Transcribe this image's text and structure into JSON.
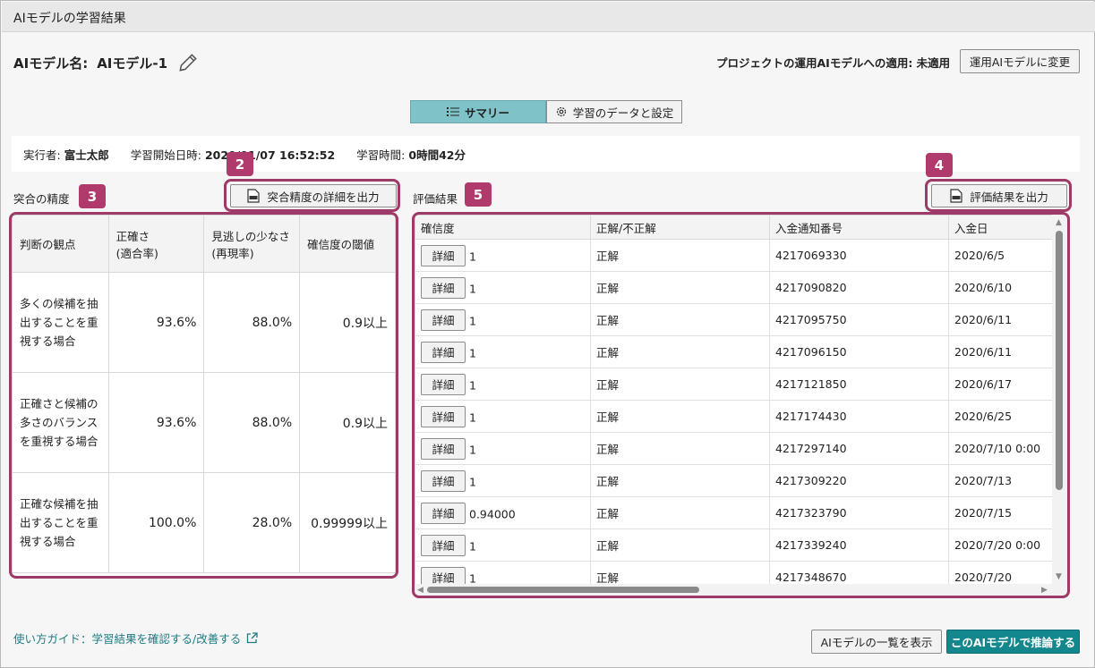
{
  "window": {
    "title": "AIモデルの学習結果"
  },
  "model": {
    "label": "AIモデル名:",
    "name": "AIモデル-1"
  },
  "apply": {
    "status_text": "プロジェクトの運用AIモデルへの適用: 未適用",
    "change_button": "運用AIモデルに変更"
  },
  "tabs": [
    {
      "label": "サマリー",
      "active": true
    },
    {
      "label": "学習のデータと設定",
      "active": false
    }
  ],
  "info": {
    "executor_label": "実行者:",
    "executor": "富士太郎",
    "start_label": "学習開始日時:",
    "start": "2020/01/07 16:52:52",
    "duration_label": "学習時間:",
    "duration": "0時間42分"
  },
  "accuracy": {
    "section_label": "突合の精度",
    "export_button": "突合精度の詳細を出力",
    "headers": [
      "判断の観点",
      "正確さ\n(適合率)",
      "見逃しの少なさ\n(再現率)",
      "確信度の閾値"
    ],
    "rows": [
      {
        "desc": "多くの候補を抽出することを重視する場合",
        "precision": "93.6%",
        "recall": "88.0%",
        "threshold": "0.9以上"
      },
      {
        "desc": "正確さと候補の多さのバランスを重視する場合",
        "precision": "93.6%",
        "recall": "88.0%",
        "threshold": "0.9以上"
      },
      {
        "desc": "正確な候補を抽出することを重視する場合",
        "precision": "100.0%",
        "recall": "28.0%",
        "threshold": "0.99999以上"
      }
    ]
  },
  "evaluation": {
    "section_label": "評価結果",
    "export_button": "評価結果を出力",
    "detail_label": "詳細",
    "headers": [
      "確信度",
      "正解/不正解",
      "入金通知番号",
      "入金日"
    ],
    "rows": [
      {
        "confidence": "1",
        "result": "正解",
        "number": "4217069330",
        "date": "2020/6/5"
      },
      {
        "confidence": "1",
        "result": "正解",
        "number": "4217090820",
        "date": "2020/6/10"
      },
      {
        "confidence": "1",
        "result": "正解",
        "number": "4217095750",
        "date": "2020/6/11"
      },
      {
        "confidence": "1",
        "result": "正解",
        "number": "4217096150",
        "date": "2020/6/11"
      },
      {
        "confidence": "1",
        "result": "正解",
        "number": "4217121850",
        "date": "2020/6/17"
      },
      {
        "confidence": "1",
        "result": "正解",
        "number": "4217174430",
        "date": "2020/6/25"
      },
      {
        "confidence": "1",
        "result": "正解",
        "number": "4217297140",
        "date": "2020/7/10 0:00"
      },
      {
        "confidence": "1",
        "result": "正解",
        "number": "4217309220",
        "date": "2020/7/13"
      },
      {
        "confidence": "0.94000",
        "result": "正解",
        "number": "4217323790",
        "date": "2020/7/15"
      },
      {
        "confidence": "1",
        "result": "正解",
        "number": "4217339240",
        "date": "2020/7/20 0:00"
      },
      {
        "confidence": "1",
        "result": "正解",
        "number": "4217348670",
        "date": "2020/7/20"
      }
    ]
  },
  "badges": [
    "2",
    "3",
    "4",
    "5"
  ],
  "footer": {
    "guide_link": "使い方ガイド：学習結果を確認する/改善する",
    "list_button": "AIモデルの一覧を表示",
    "infer_button": "このAIモデルで推論する"
  },
  "colors": {
    "accent": "#14878d",
    "tab_active": "#7fc3c8",
    "highlight": "#9e3a67",
    "badge": "#b03a6b"
  },
  "icons": {
    "edit": "pencil-icon",
    "summary_tab": "list-icon",
    "settings_tab": "gear-icon",
    "export": "csv-file-icon",
    "external": "external-link-icon"
  }
}
